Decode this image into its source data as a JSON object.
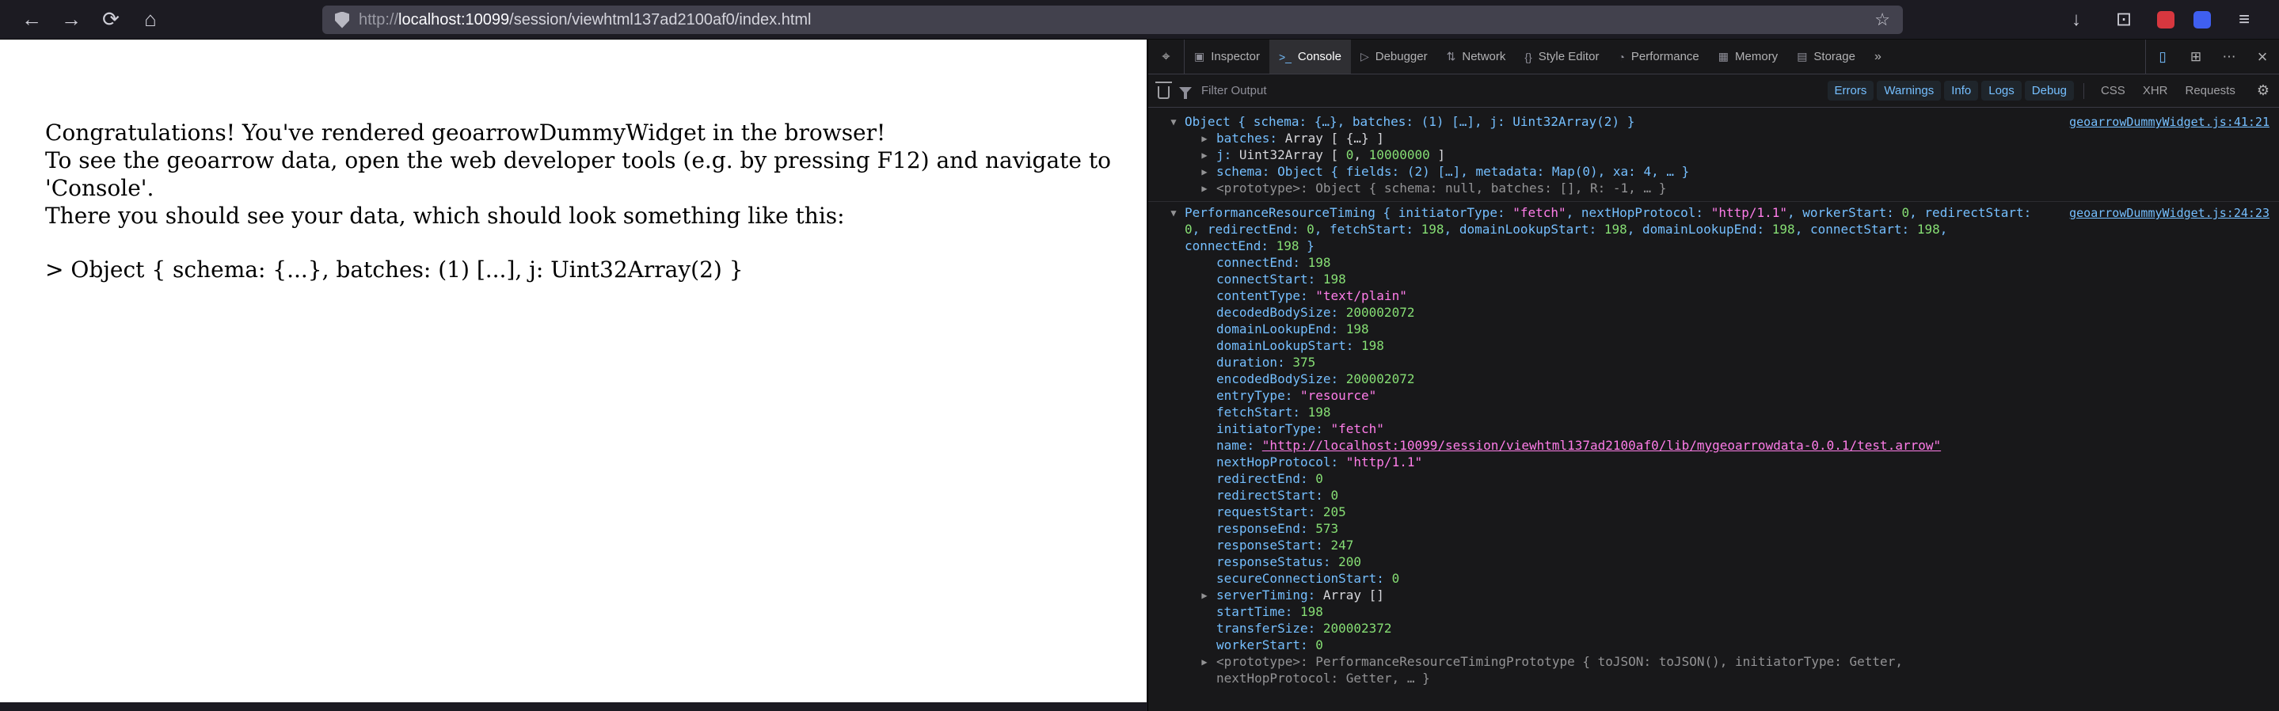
{
  "browser": {
    "icons": {
      "back": "←",
      "forward": "→",
      "reload": "⟳",
      "home": "⌂",
      "star": "☆",
      "download": "↓",
      "extensions": "⊡",
      "menu": "≡"
    },
    "url": {
      "protocol": "http://",
      "host": "localhost:10099",
      "path": "/session/viewhtml137ad2100af0/index.html"
    }
  },
  "page": {
    "line1": "Congratulations! You've rendered geoarrowDummyWidget in the browser!",
    "line2": "To see the geoarrow data, open the web developer tools (e.g. by pressing F12) and navigate to 'Console'.",
    "line3": "There you should see your data, which should look something like this:",
    "example": "> Object { schema: {...}, batches: (1) [...], j: Uint32Array(2) }"
  },
  "devtools": {
    "pick_icon": "⌖",
    "more_tabs_icon": "»",
    "tabs": [
      {
        "label": "Inspector",
        "icon": "▣",
        "icon_name": "inspector-icon",
        "active": false
      },
      {
        "label": "Console",
        "icon": ">_",
        "icon_name": "console-icon",
        "active": true
      },
      {
        "label": "Debugger",
        "icon": "▷",
        "icon_name": "debugger-icon",
        "active": false
      },
      {
        "label": "Network",
        "icon": "⇅",
        "icon_name": "network-icon",
        "active": false
      },
      {
        "label": "Style Editor",
        "icon": "{}",
        "icon_name": "style-editor-icon",
        "active": false
      },
      {
        "label": "Performance",
        "icon": "◔",
        "icon_name": "performance-icon",
        "active": false
      },
      {
        "label": "Memory",
        "icon": "▦",
        "icon_name": "memory-icon",
        "active": false
      },
      {
        "label": "Storage",
        "icon": "▤",
        "icon_name": "storage-icon",
        "active": false
      }
    ],
    "toolbar_icons": [
      {
        "name": "responsive-design-mode-icon",
        "glyph": "▯",
        "active": true
      },
      {
        "name": "split-console-icon",
        "glyph": "⊞",
        "active": false
      },
      {
        "name": "devtools-menu-icon",
        "glyph": "⋯",
        "active": false
      },
      {
        "name": "close-devtools-icon",
        "glyph": "×",
        "active": false,
        "close": true
      }
    ],
    "filter": {
      "placeholder": "Filter Output",
      "levels": [
        "Errors",
        "Warnings",
        "Info",
        "Logs",
        "Debug"
      ],
      "categories": [
        "CSS",
        "XHR",
        "Requests"
      ],
      "gear_icon": "⚙"
    },
    "console": {
      "twisty_open": "▼",
      "twisty_closed": "▶",
      "rows": [
        {
          "name": "log-object",
          "entry_start": true,
          "indent": 0,
          "twisty": "open",
          "link": "geoarrowDummyWidget.js:41:21",
          "segments": [
            {
              "t": "obj",
              "x": "Object { schema: {…}, batches: (1) […], j: Uint32Array(2) }"
            }
          ]
        },
        {
          "name": "prop-batches",
          "indent": 1,
          "twisty": "closed",
          "segments": [
            {
              "t": "key",
              "x": "batches: "
            },
            {
              "t": "plain",
              "x": "Array [ {…} ]"
            }
          ]
        },
        {
          "name": "prop-j",
          "indent": 1,
          "twisty": "closed",
          "segments": [
            {
              "t": "key",
              "x": "j: "
            },
            {
              "t": "plain",
              "x": "Uint32Array [ "
            },
            {
              "t": "num",
              "x": "0"
            },
            {
              "t": "plain",
              "x": ", "
            },
            {
              "t": "num",
              "x": "10000000"
            },
            {
              "t": "plain",
              "x": " ]"
            }
          ]
        },
        {
          "name": "prop-schema",
          "indent": 1,
          "twisty": "closed",
          "segments": [
            {
              "t": "key",
              "x": "schema: "
            },
            {
              "t": "obj",
              "x": "Object { fields: (2) […], metadata: Map(0), xa: 4, … }"
            }
          ]
        },
        {
          "name": "prop-prototype-object",
          "indent": 1,
          "twisty": "closed",
          "segments": [
            {
              "t": "dim",
              "x": "<prototype>: Object { schema: null, batches: [], R: -1, … }"
            }
          ]
        },
        {
          "name": "log-performance-resource-timing",
          "entry_start": true,
          "indent": 0,
          "twisty": "open",
          "link": "geoarrowDummyWidget.js:24:23",
          "segments": [
            {
              "t": "obj",
              "x": "PerformanceResourceTiming { initiatorType: "
            },
            {
              "t": "str",
              "x": "\"fetch\""
            },
            {
              "t": "obj",
              "x": ", nextHopProtocol: "
            },
            {
              "t": "str",
              "x": "\"http/1.1\""
            },
            {
              "t": "obj",
              "x": ", workerStart: "
            },
            {
              "t": "num",
              "x": "0"
            },
            {
              "t": "obj",
              "x": ", redirectStart: "
            },
            {
              "t": "num",
              "x": "0"
            },
            {
              "t": "obj",
              "x": ", redirectEnd: "
            },
            {
              "t": "num",
              "x": "0"
            },
            {
              "t": "obj",
              "x": ", fetchStart: "
            },
            {
              "t": "num",
              "x": "198"
            },
            {
              "t": "obj",
              "x": ", domainLookupStart: "
            },
            {
              "t": "num",
              "x": "198"
            },
            {
              "t": "obj",
              "x": ", domainLookupEnd: "
            },
            {
              "t": "num",
              "x": "198"
            },
            {
              "t": "obj",
              "x": ", connectStart: "
            },
            {
              "t": "num",
              "x": "198"
            },
            {
              "t": "obj",
              "x": ", connectEnd: "
            },
            {
              "t": "num",
              "x": "198"
            },
            {
              "t": "obj",
              "x": " }"
            }
          ]
        },
        {
          "name": "prop-connectEnd",
          "indent": 1,
          "segments": [
            {
              "t": "key",
              "x": "connectEnd: "
            },
            {
              "t": "num",
              "x": "198"
            }
          ]
        },
        {
          "name": "prop-connectStart",
          "indent": 1,
          "segments": [
            {
              "t": "key",
              "x": "connectStart: "
            },
            {
              "t": "num",
              "x": "198"
            }
          ]
        },
        {
          "name": "prop-contentType",
          "indent": 1,
          "segments": [
            {
              "t": "key",
              "x": "contentType: "
            },
            {
              "t": "str",
              "x": "\"text/plain\""
            }
          ]
        },
        {
          "name": "prop-decodedBodySize",
          "indent": 1,
          "segments": [
            {
              "t": "key",
              "x": "decodedBodySize: "
            },
            {
              "t": "num",
              "x": "200002072"
            }
          ]
        },
        {
          "name": "prop-domainLookupEnd",
          "indent": 1,
          "segments": [
            {
              "t": "key",
              "x": "domainLookupEnd: "
            },
            {
              "t": "num",
              "x": "198"
            }
          ]
        },
        {
          "name": "prop-domainLookupStart",
          "indent": 1,
          "segments": [
            {
              "t": "key",
              "x": "domainLookupStart: "
            },
            {
              "t": "num",
              "x": "198"
            }
          ]
        },
        {
          "name": "prop-duration",
          "indent": 1,
          "segments": [
            {
              "t": "key",
              "x": "duration: "
            },
            {
              "t": "num",
              "x": "375"
            }
          ]
        },
        {
          "name": "prop-encodedBodySize",
          "indent": 1,
          "segments": [
            {
              "t": "key",
              "x": "encodedBodySize: "
            },
            {
              "t": "num",
              "x": "200002072"
            }
          ]
        },
        {
          "name": "prop-entryType",
          "indent": 1,
          "segments": [
            {
              "t": "key",
              "x": "entryType: "
            },
            {
              "t": "str",
              "x": "\"resource\""
            }
          ]
        },
        {
          "name": "prop-fetchStart",
          "indent": 1,
          "segments": [
            {
              "t": "key",
              "x": "fetchStart: "
            },
            {
              "t": "num",
              "x": "198"
            }
          ]
        },
        {
          "name": "prop-initiatorType",
          "indent": 1,
          "segments": [
            {
              "t": "key",
              "x": "initiatorType: "
            },
            {
              "t": "str",
              "x": "\"fetch\""
            }
          ]
        },
        {
          "name": "prop-name",
          "indent": 1,
          "segments": [
            {
              "t": "key",
              "x": "name: "
            },
            {
              "t": "url",
              "x": "\"http://localhost:10099/session/viewhtml137ad2100af0/lib/mygeoarrowdata-0.0.1/test.arrow\""
            }
          ]
        },
        {
          "name": "prop-nextHopProtocol",
          "indent": 1,
          "segments": [
            {
              "t": "key",
              "x": "nextHopProtocol: "
            },
            {
              "t": "str",
              "x": "\"http/1.1\""
            }
          ]
        },
        {
          "name": "prop-redirectEnd",
          "indent": 1,
          "segments": [
            {
              "t": "key",
              "x": "redirectEnd: "
            },
            {
              "t": "num",
              "x": "0"
            }
          ]
        },
        {
          "name": "prop-redirectStart",
          "indent": 1,
          "segments": [
            {
              "t": "key",
              "x": "redirectStart: "
            },
            {
              "t": "num",
              "x": "0"
            }
          ]
        },
        {
          "name": "prop-requestStart",
          "indent": 1,
          "segments": [
            {
              "t": "key",
              "x": "requestStart: "
            },
            {
              "t": "num",
              "x": "205"
            }
          ]
        },
        {
          "name": "prop-responseEnd",
          "indent": 1,
          "segments": [
            {
              "t": "key",
              "x": "responseEnd: "
            },
            {
              "t": "num",
              "x": "573"
            }
          ]
        },
        {
          "name": "prop-responseStart",
          "indent": 1,
          "segments": [
            {
              "t": "key",
              "x": "responseStart: "
            },
            {
              "t": "num",
              "x": "247"
            }
          ]
        },
        {
          "name": "prop-responseStatus",
          "indent": 1,
          "segments": [
            {
              "t": "key",
              "x": "responseStatus: "
            },
            {
              "t": "num",
              "x": "200"
            }
          ]
        },
        {
          "name": "prop-secureConnectionStart",
          "indent": 1,
          "segments": [
            {
              "t": "key",
              "x": "secureConnectionStart: "
            },
            {
              "t": "num",
              "x": "0"
            }
          ]
        },
        {
          "name": "prop-serverTiming",
          "indent": 1,
          "twisty": "closed",
          "segments": [
            {
              "t": "key",
              "x": "serverTiming: "
            },
            {
              "t": "plain",
              "x": "Array []"
            }
          ]
        },
        {
          "name": "prop-startTime",
          "indent": 1,
          "segments": [
            {
              "t": "key",
              "x": "startTime: "
            },
            {
              "t": "num",
              "x": "198"
            }
          ]
        },
        {
          "name": "prop-transferSize",
          "indent": 1,
          "segments": [
            {
              "t": "key",
              "x": "transferSize: "
            },
            {
              "t": "num",
              "x": "200002372"
            }
          ]
        },
        {
          "name": "prop-workerStart",
          "indent": 1,
          "segments": [
            {
              "t": "key",
              "x": "workerStart: "
            },
            {
              "t": "num",
              "x": "0"
            }
          ]
        },
        {
          "name": "prop-prototype-performance",
          "indent": 1,
          "twisty": "closed",
          "narrow": true,
          "segments": [
            {
              "t": "dim",
              "x": "<prototype>: PerformanceResourceTimingPrototype { toJSON: toJSON(), initiatorType: Getter, nextHopProtocol: Getter, … }"
            }
          ]
        }
      ]
    }
  }
}
